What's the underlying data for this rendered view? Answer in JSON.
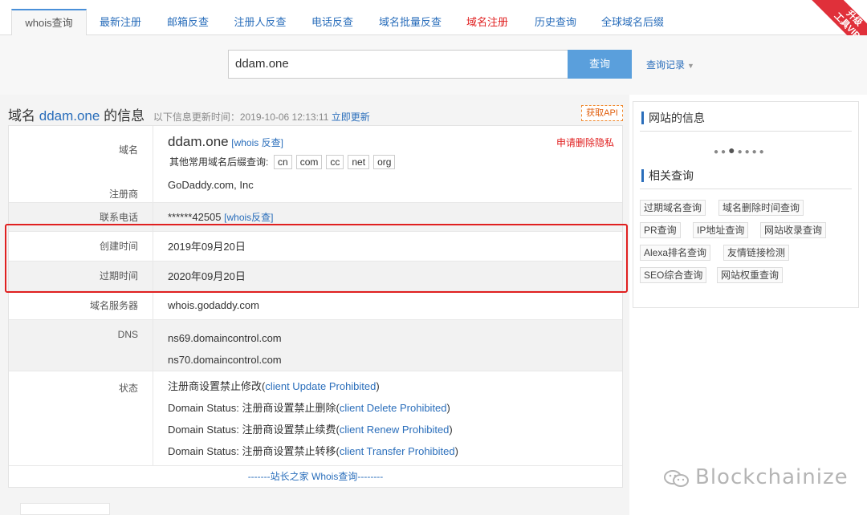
{
  "nav": {
    "tabs": [
      {
        "label": "whois查询"
      },
      {
        "label": "最新注册"
      },
      {
        "label": "邮箱反查"
      },
      {
        "label": "注册人反查"
      },
      {
        "label": "电话反查"
      },
      {
        "label": "域名批量反查"
      },
      {
        "label": "域名注册"
      },
      {
        "label": "历史查询"
      },
      {
        "label": "全球域名后缀"
      }
    ],
    "vip_line1": "升级",
    "vip_line2": "工具VIP"
  },
  "search": {
    "value": "ddam.one",
    "button": "查询",
    "history": "查询记录"
  },
  "result": {
    "title_prefix": "域名 ",
    "domain": "ddam.one",
    "title_suffix": " 的信息",
    "updated_label": "以下信息更新时间：2019-10-06 12:13:11",
    "update_now": "立即更新",
    "api": "获取API",
    "delete_privacy": "申请删除隐私",
    "rows": {
      "domain_label": "域名",
      "domain_value": "ddam.one",
      "whois_reverse": "[whois 反查]",
      "suffix_label": "其他常用域名后缀查询:",
      "suffixes": [
        "cn",
        "com",
        "cc",
        "net",
        "org"
      ],
      "registrar_label": "注册商",
      "registrar_value": "GoDaddy.com, Inc",
      "phone_label": "联系电话",
      "phone_value": "******42505",
      "phone_reverse": "[whois反查]",
      "created_label": "创建时间",
      "created_value": "2019年09月20日",
      "expires_label": "过期时间",
      "expires_value": "2020年09月20日",
      "server_label": "域名服务器",
      "server_value": "whois.godaddy.com",
      "dns_label": "DNS",
      "dns_values": [
        "ns69.domaincontrol.com",
        "ns70.domaincontrol.com"
      ],
      "status_label": "状态",
      "statuses": [
        {
          "prefix": "注册商设置禁止修改(",
          "code": "client Update Prohibited",
          "suffix": ")"
        },
        {
          "prefix": "Domain Status: 注册商设置禁止删除(",
          "code": "client Delete Prohibited",
          "suffix": ")"
        },
        {
          "prefix": "Domain Status: 注册商设置禁止续费(",
          "code": "client Renew Prohibited",
          "suffix": ")"
        },
        {
          "prefix": "Domain Status: 注册商设置禁止转移(",
          "code": "client Transfer Prohibited",
          "suffix": ")"
        }
      ]
    },
    "footer": "-------站长之家 Whois查询--------"
  },
  "sidebar": {
    "site_info_title": "网站的信息",
    "related_title": "相关查询",
    "links": [
      "过期域名查询",
      "域名删除时间查询",
      "PR查询",
      "IP地址查询",
      "网站收录查询",
      "Alexa排名查询",
      "友情链接检测",
      "SEO综合查询",
      "网站权重查询"
    ]
  },
  "watermark": "Blockchainize",
  "colors": {
    "accent": "#2a6ebb",
    "button": "#5a9fdc",
    "highlight": "#e02020"
  }
}
